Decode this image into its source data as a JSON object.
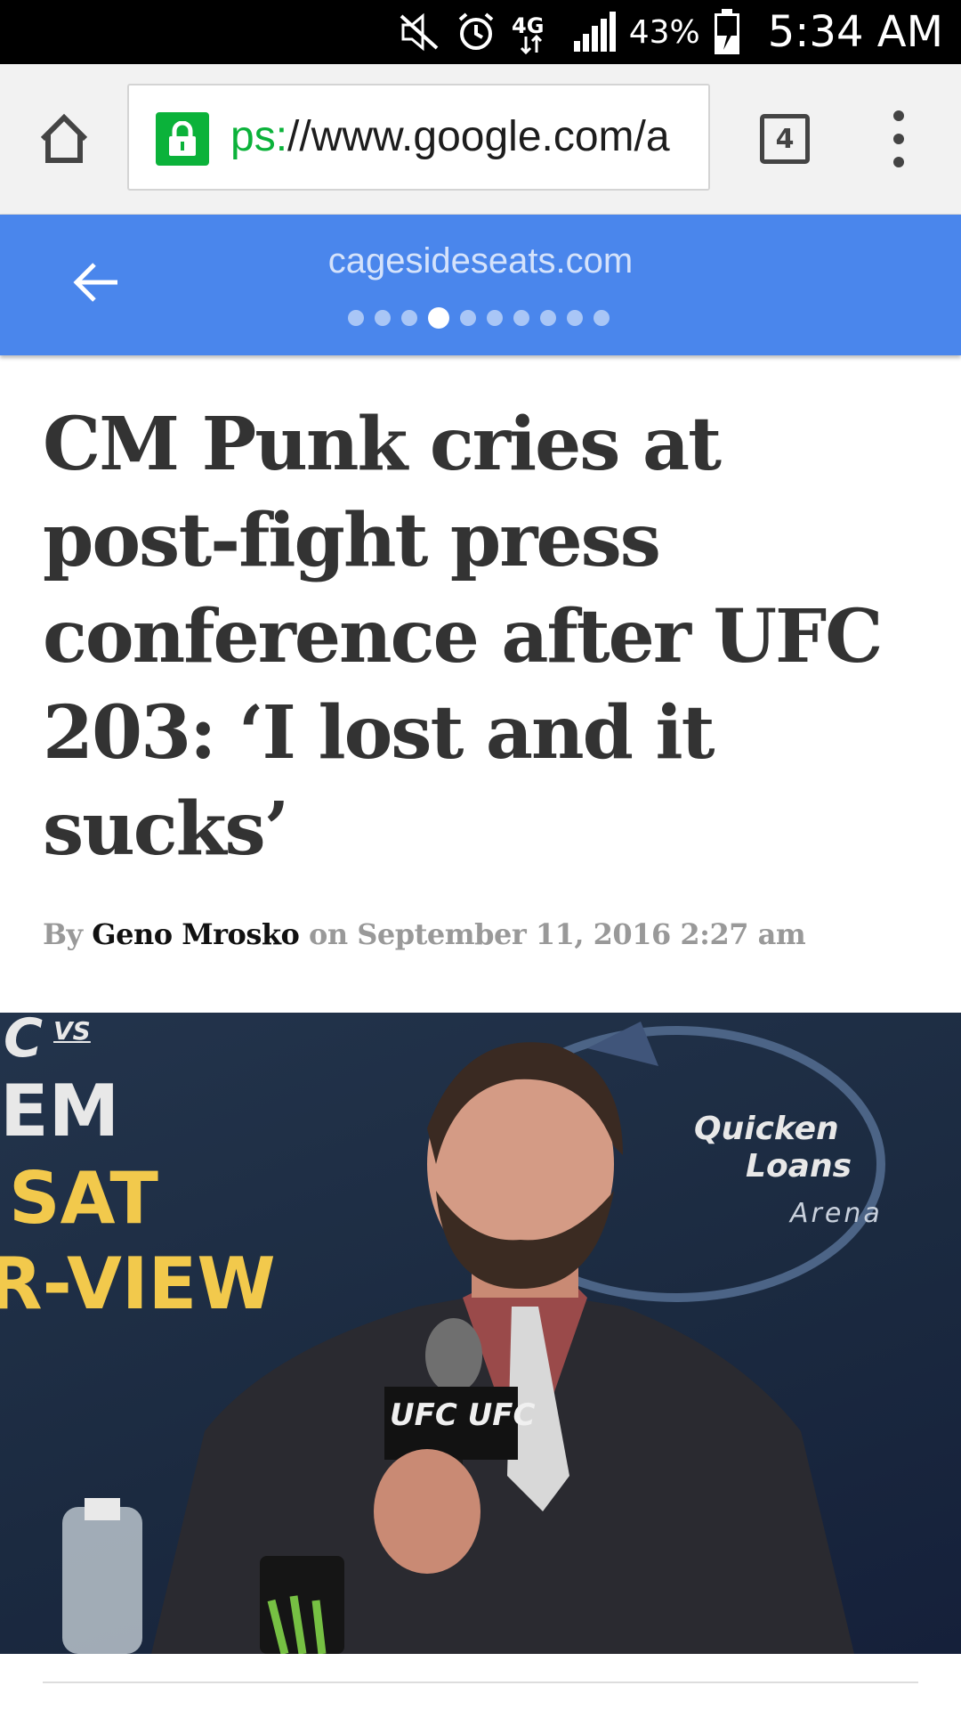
{
  "status_bar": {
    "network": "4G",
    "battery_percent": "43%",
    "time": "5:34 AM",
    "icons": [
      "mute-icon",
      "alarm-icon",
      "network-4g-lte-icon",
      "signal-icon",
      "battery-charging-icon"
    ]
  },
  "browser": {
    "url_scheme_fragment": "ps:",
    "url_rest": "//www.google.com/a",
    "tab_count": "4",
    "icons": [
      "home-icon",
      "lock-icon",
      "overflow-menu-icon"
    ]
  },
  "amp_viewer": {
    "domain": "cagesideseats.com",
    "page_count": 10,
    "active_page_index": 3,
    "bar_color": "#4a86ec"
  },
  "article": {
    "headline": "CM Punk cries at post-fight press conference after UFC 203: ‘I lost and it sucks’",
    "byline_by": "By ",
    "author": "Geno Mrosko",
    "byline_on": " on September 11, 2016 2:27 am"
  },
  "photo": {
    "backdrop_lines": [
      "C",
      "VS",
      "EM",
      "SAT",
      "R-VIEW"
    ],
    "sponsor_name": "Quicken",
    "sponsor_name_2": "Loans",
    "venue_word": "Arena",
    "mic_flag_text": "UFC UFC"
  }
}
